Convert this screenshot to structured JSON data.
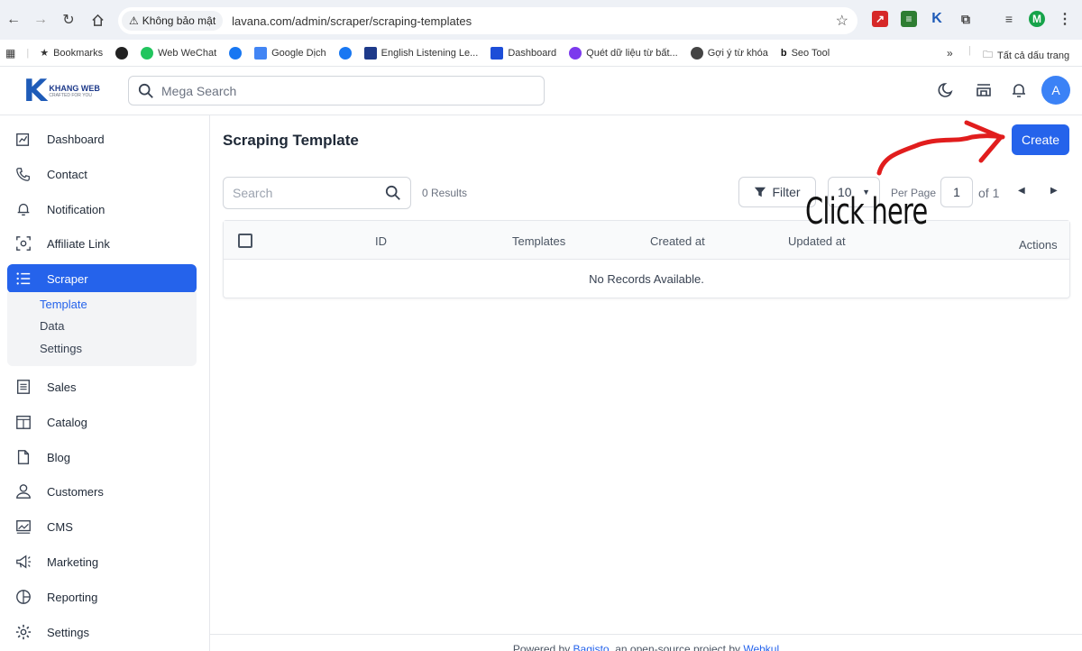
{
  "browser": {
    "security_label": "Không bảo mật",
    "url": "lavana.com/admin/scraper/scraping-templates",
    "profile_initial": "M",
    "bookmarks": [
      {
        "label": "Bookmarks",
        "icon": "star-icon"
      },
      {
        "label": "",
        "icon": "github-icon"
      },
      {
        "label": "Web WeChat",
        "icon": "wechat-icon"
      },
      {
        "label": "",
        "icon": "facebook-icon"
      },
      {
        "label": "Google Dịch",
        "icon": "google-translate-icon"
      },
      {
        "label": "",
        "icon": "facebook-icon"
      },
      {
        "label": "English Listening Le...",
        "icon": "english-listening-icon"
      },
      {
        "label": "Dashboard",
        "icon": "bag-icon"
      },
      {
        "label": "Quét dữ liệu từ bất...",
        "icon": "scraper-icon"
      },
      {
        "label": "Gợi ý từ khóa",
        "icon": "keyword-icon"
      },
      {
        "label": "Seo Tool",
        "icon": "seo-icon"
      }
    ],
    "all_bookmarks_label": "Tất cả dấu trang"
  },
  "header": {
    "logo_name": "KHANG WEB",
    "logo_tagline": "CRAFTED FOR YOU",
    "search_placeholder": "Mega Search",
    "avatar_initial": "A"
  },
  "sidebar": {
    "items": [
      {
        "label": "Dashboard",
        "icon": "dashboard-icon"
      },
      {
        "label": "Contact",
        "icon": "phone-icon"
      },
      {
        "label": "Notification",
        "icon": "bell-icon"
      },
      {
        "label": "Affiliate Link",
        "icon": "affiliate-icon"
      },
      {
        "label": "Scraper",
        "icon": "list-icon"
      },
      {
        "label": "Sales",
        "icon": "receipt-icon"
      },
      {
        "label": "Catalog",
        "icon": "catalog-icon"
      },
      {
        "label": "Blog",
        "icon": "file-icon"
      },
      {
        "label": "Customers",
        "icon": "user-icon"
      },
      {
        "label": "CMS",
        "icon": "cms-icon"
      },
      {
        "label": "Marketing",
        "icon": "megaphone-icon"
      },
      {
        "label": "Reporting",
        "icon": "reporting-icon"
      },
      {
        "label": "Settings",
        "icon": "gear-icon"
      }
    ],
    "active": "Scraper",
    "subitems": [
      {
        "label": "Template"
      },
      {
        "label": "Data"
      },
      {
        "label": "Settings"
      }
    ]
  },
  "main": {
    "title": "Scraping Template",
    "create_label": "Create",
    "search_placeholder": "Search",
    "results": "0 Results",
    "filter_label": "Filter",
    "per_page_value": "10",
    "per_page_label": "Per Page",
    "page_value": "1",
    "of_label": "of 1",
    "columns": [
      "ID",
      "Templates",
      "Created at",
      "Updated at",
      "Actions"
    ],
    "empty_text": "No Records Available."
  },
  "footer": {
    "prefix": "Powered by ",
    "link1": "Bagisto",
    "middle": ", an open-source project by ",
    "link2": "Webkul"
  },
  "annotation": {
    "text": "Click here"
  },
  "colors": {
    "accent": "#2563eb",
    "annotation_arrow": "#e11d1d"
  }
}
